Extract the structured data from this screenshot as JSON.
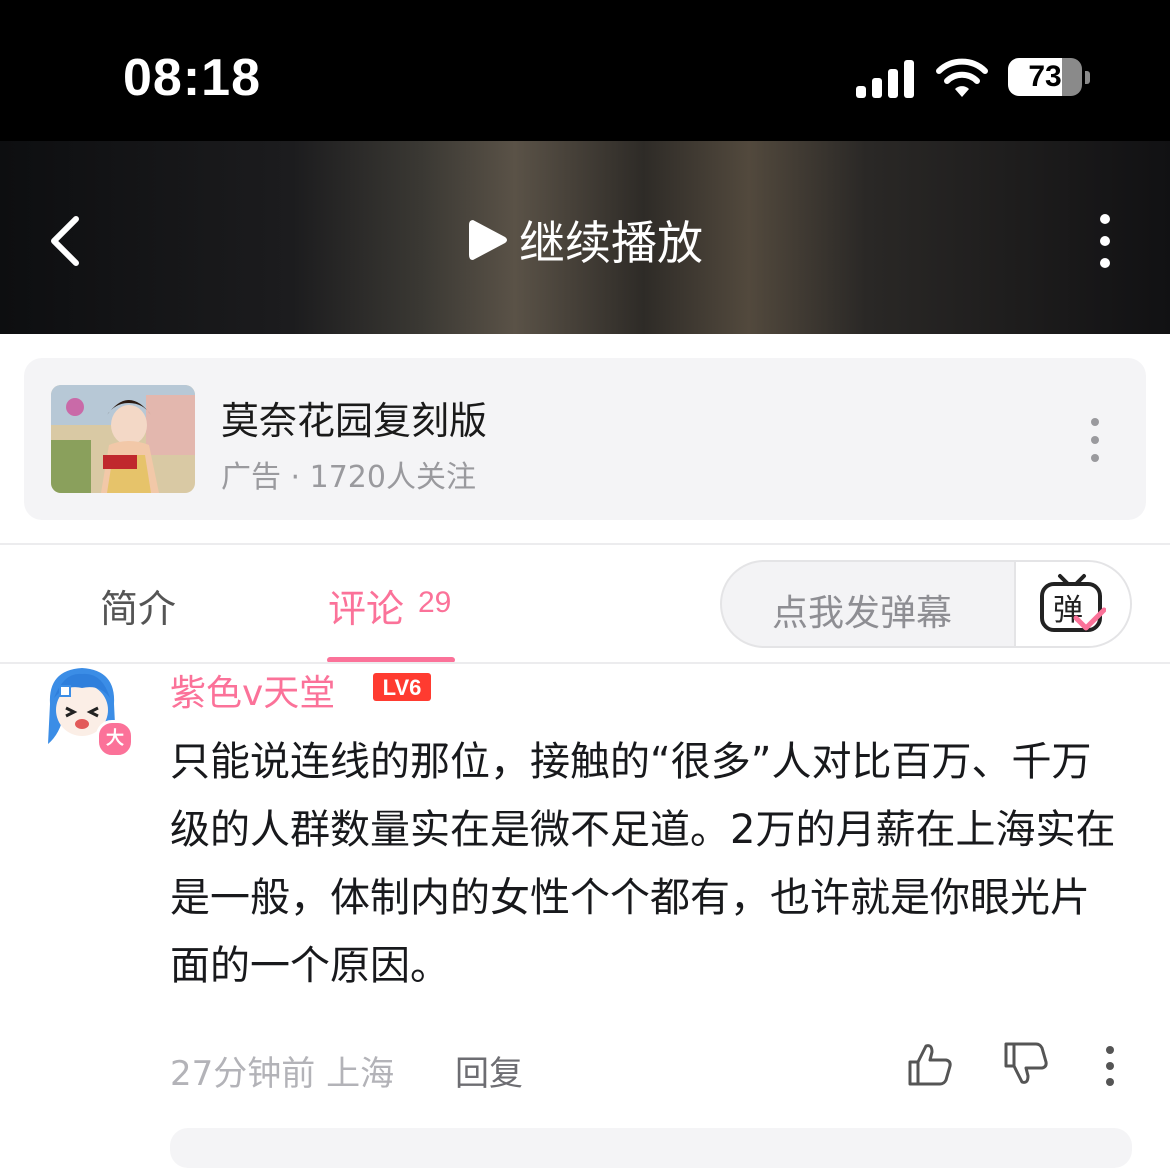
{
  "status": {
    "time": "08:18",
    "battery": "73",
    "battery_level": 0.73
  },
  "player": {
    "resume_label": "继续播放"
  },
  "ad": {
    "title": "莫奈花园复刻版",
    "subtitle": "广告 · 1720人关注"
  },
  "tabs": {
    "intro": "简介",
    "comments": "评论",
    "comments_count": "29",
    "danmaku_placeholder": "点我发弹幕",
    "danmaku_icon_char": "弹"
  },
  "comment": {
    "username": "紫色v天堂",
    "level": "LV6",
    "avatar_badge": "大",
    "text": "只能说连线的那位，接触的“很多”人对比百万、千万级的人群数量实在是微不足道。2万的月薪在上海实在是一般，体制内的女性个个都有，也许就是你眼光片面的一个原因。",
    "time_location": "27分钟前 上海",
    "reply_label": "回复"
  },
  "colors": {
    "accent_pink": "#fb7299",
    "status_bar": "#000000"
  }
}
